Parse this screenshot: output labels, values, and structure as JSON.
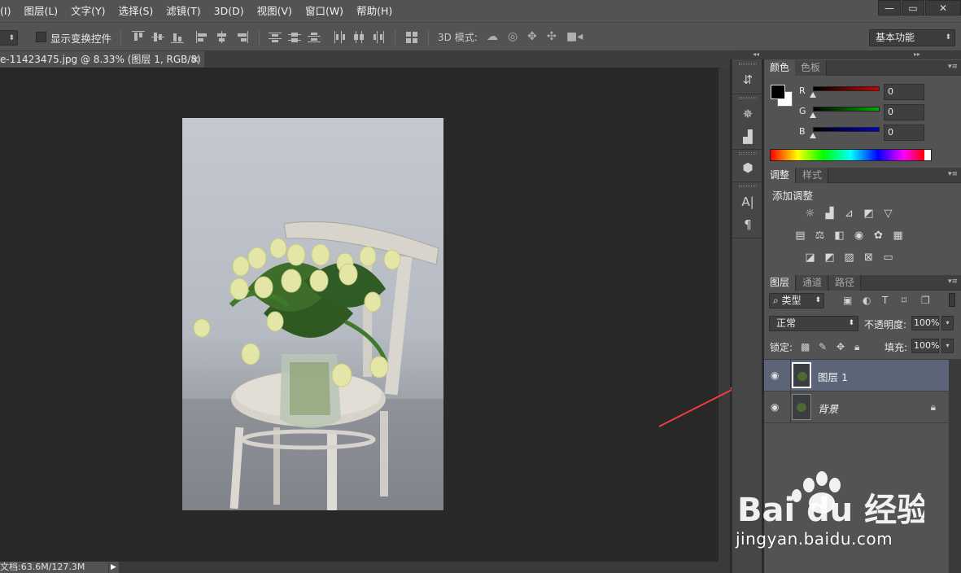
{
  "menu": {
    "items": [
      "(I)",
      "图层(L)",
      "文字(Y)",
      "选择(S)",
      "滤镜(T)",
      "3D(D)",
      "视图(V)",
      "窗口(W)",
      "帮助(H)"
    ],
    "window_controls": [
      "—",
      "▭",
      "✕"
    ]
  },
  "options": {
    "show_transform_controls": "显示变换控件",
    "mode_3d_label": "3D 模式:",
    "workspace": "基本功能"
  },
  "document": {
    "tab_title": "e-11423475.jpg @ 8.33% (图层 1, RGB/8) *",
    "close": "×",
    "status": "文档:63.6M/127.3M"
  },
  "color_panel": {
    "tabs": [
      "颜色",
      "色板"
    ],
    "channels": [
      {
        "label": "R",
        "value": "0",
        "color": "#d00000"
      },
      {
        "label": "G",
        "value": "0",
        "color": "#00b000"
      },
      {
        "label": "B",
        "value": "0",
        "color": "#0000d0"
      }
    ]
  },
  "adjust_panel": {
    "tabs": [
      "调整",
      "样式"
    ],
    "title": "添加调整",
    "icons_row1": [
      "brightness-contrast-icon",
      "levels-icon",
      "curves-icon",
      "exposure-icon",
      "vibrance-icon"
    ],
    "icons_row2": [
      "hue-saturation-icon",
      "color-balance-icon",
      "black-white-icon",
      "photo-filter-icon",
      "channel-mixer-icon",
      "color-lookup-icon"
    ],
    "icons_row3": [
      "invert-icon",
      "posterize-icon",
      "threshold-icon",
      "selective-color-icon",
      "gradient-map-icon"
    ]
  },
  "layers_panel": {
    "tabs": [
      "图层",
      "通道",
      "路径"
    ],
    "filter_kind": "类型",
    "blend_mode": "正常",
    "opacity_label": "不透明度:",
    "opacity_value": "100%",
    "lock_label": "锁定:",
    "fill_label": "填充:",
    "fill_value": "100%",
    "layers": [
      {
        "name": "图层 1",
        "selected": true,
        "locked": false
      },
      {
        "name": "背景",
        "selected": false,
        "locked": true
      }
    ]
  },
  "watermark": {
    "brand": "Bai du 经验",
    "url": "jingyan.baidu.com"
  }
}
